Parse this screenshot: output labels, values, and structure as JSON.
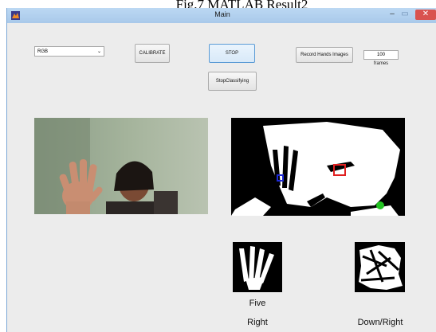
{
  "caption": "Fig.7 MATLAB Result2",
  "window": {
    "title": "Main",
    "minimize_glyph": "–",
    "maximize_glyph": "▭",
    "close_glyph": "✕",
    "app_icon": "matlab-icon"
  },
  "controls": {
    "color_mode": {
      "selected": "RGB",
      "caret": "⌄"
    },
    "calibrate_label": "CALIBRATE",
    "stop_label": "STOP",
    "stop_classifying_label": "StopClassifying",
    "record_label": "Record Hands Images",
    "frames_value": "100",
    "frames_label": "frames"
  },
  "results": {
    "gesture": "Five",
    "hand": "Right",
    "direction": "Down/Right"
  },
  "colors": {
    "titlebar": "#bcd8f3",
    "window_bg": "#ececec",
    "close_button": "#d9534f",
    "marker_blue": "#1f2bd6",
    "marker_red": "#e02020",
    "marker_green": "#22c322"
  }
}
